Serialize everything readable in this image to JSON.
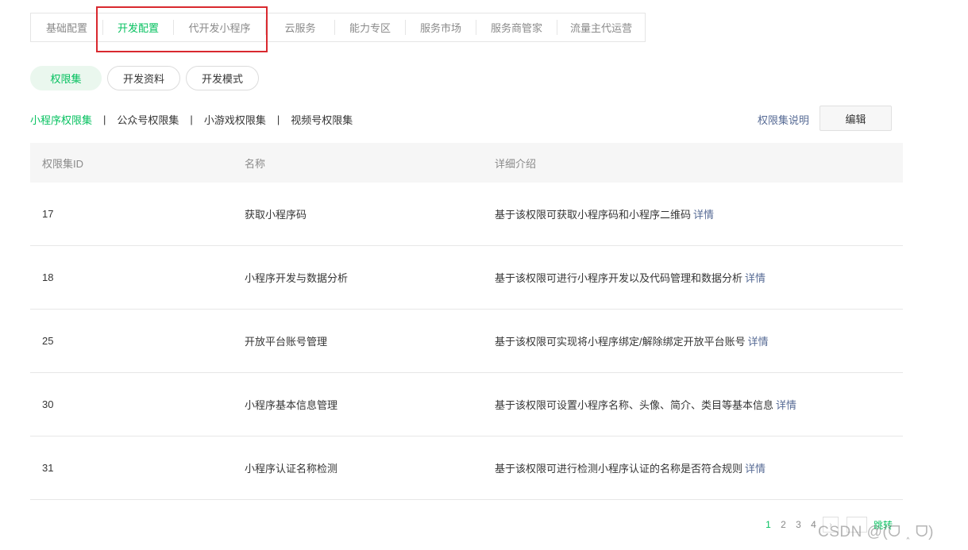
{
  "topnav": {
    "items": [
      "基础配置",
      "开发配置",
      "代开发小程序",
      "云服务",
      "能力专区",
      "服务市场",
      "服务商管家",
      "流量主代运营"
    ],
    "active_index": 1
  },
  "pills": [
    "权限集",
    "开发资料",
    "开发模式"
  ],
  "subtabs": [
    "小程序权限集",
    "公众号权限集",
    "小游戏权限集",
    "视频号权限集"
  ],
  "explain_link": "权限集说明",
  "edit_button": "编辑",
  "table": {
    "headers": [
      "权限集ID",
      "名称",
      "详细介绍"
    ],
    "detail_link": "详情",
    "rows": [
      {
        "id": "17",
        "name": "获取小程序码",
        "desc": "基于该权限可获取小程序码和小程序二维码"
      },
      {
        "id": "18",
        "name": "小程序开发与数据分析",
        "desc": "基于该权限可进行小程序开发以及代码管理和数据分析"
      },
      {
        "id": "25",
        "name": "开放平台账号管理",
        "desc": "基于该权限可实现将小程序绑定/解除绑定开放平台账号"
      },
      {
        "id": "30",
        "name": "小程序基本信息管理",
        "desc": "基于该权限可设置小程序名称、头像、简介、类目等基本信息"
      },
      {
        "id": "31",
        "name": "小程序认证名称检测",
        "desc": "基于该权限可进行检测小程序认证的名称是否符合规则"
      }
    ]
  },
  "pagination": {
    "pages": [
      "1",
      "2",
      "3",
      "4"
    ],
    "current": "1",
    "next_symbol": "›",
    "jump_label": "跳转"
  },
  "watermark": "CSDN @(ᗜ ˰ ᗜ)",
  "colors": {
    "accent": "#07c160",
    "link": "#576b95",
    "highlight": "#d9292f"
  }
}
